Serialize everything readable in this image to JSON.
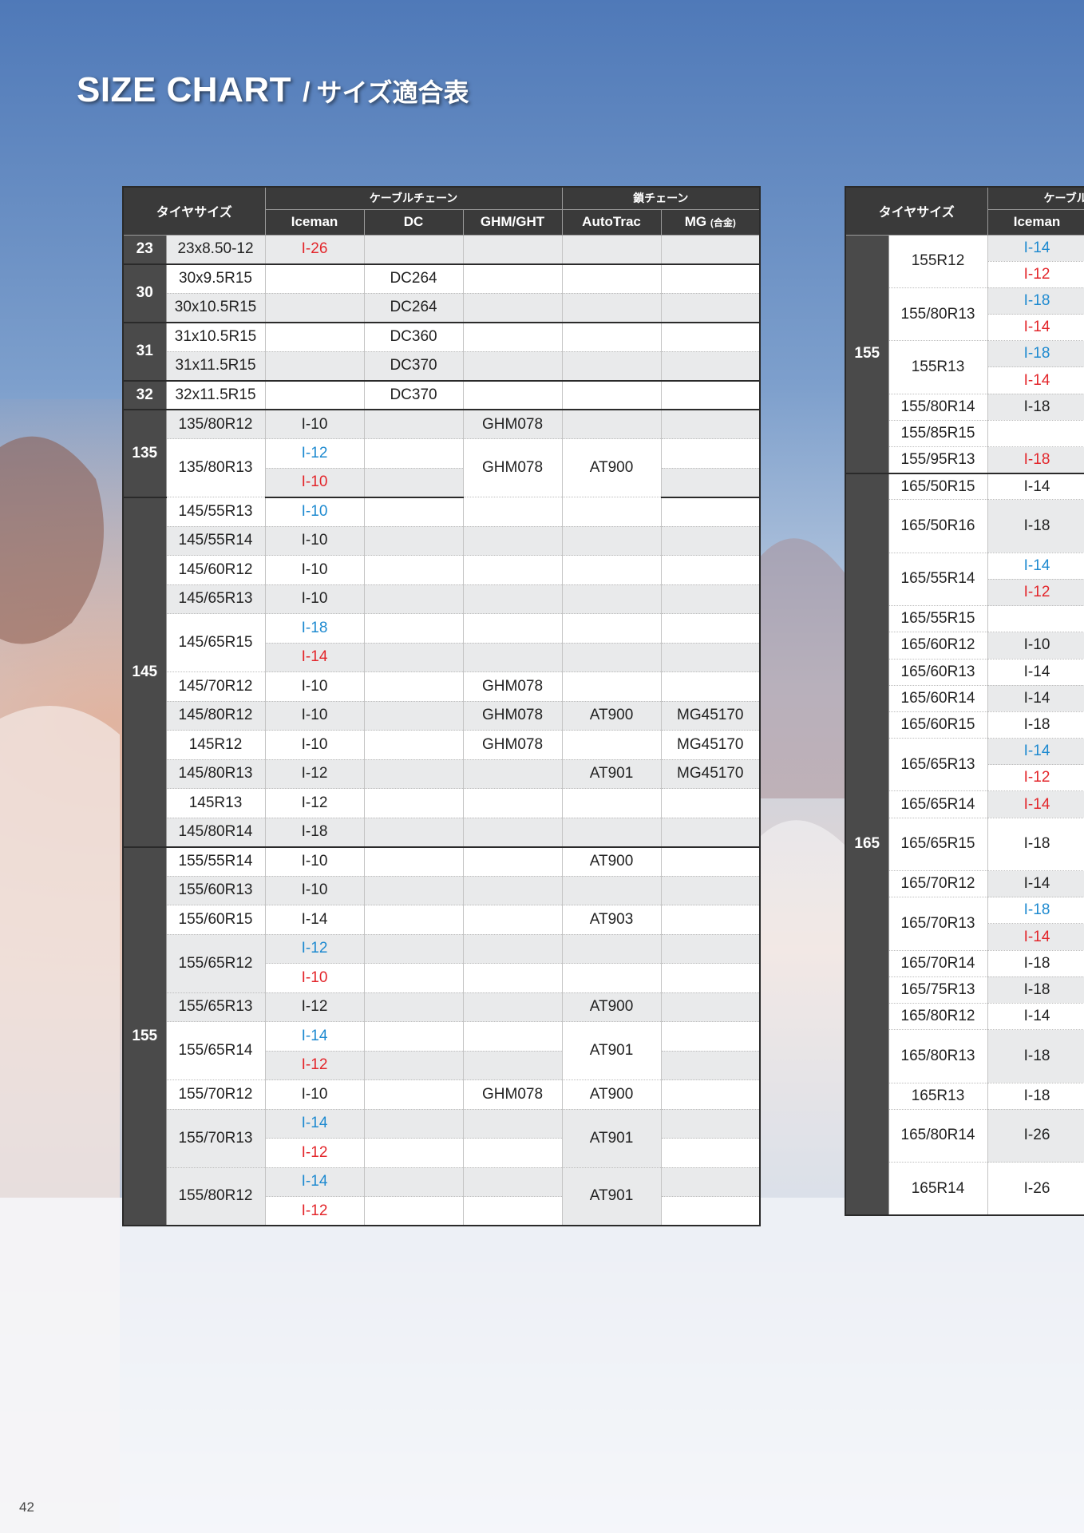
{
  "title": {
    "main": "SIZE CHART",
    "separator": "/",
    "sub": "サイズ適合表"
  },
  "page_number": "42",
  "colors": {
    "blue": "#1e8ad0",
    "red": "#e3262b",
    "header_bg": "#3a3a3a"
  },
  "left_table": {
    "headers": {
      "tire_size": "タイヤサイズ",
      "cable_chain": "ケーブルチェーン",
      "steel_chain": "鎖チェーン",
      "iceman": "Iceman",
      "dc": "DC",
      "ghm": "GHM/GHT",
      "autotrac": "AutoTrac",
      "mg": "MG",
      "mg_note": "(合金)"
    },
    "groups": [
      {
        "label": "23",
        "rows": [
          {
            "size": "23x8.50-12",
            "iceman": [
              {
                "v": "I-26",
                "c": "red"
              }
            ],
            "dc": "",
            "ghm": "",
            "at": "",
            "mg": ""
          }
        ]
      },
      {
        "label": "30",
        "rows": [
          {
            "size": "30x9.5R15",
            "iceman": [],
            "dc": "DC264",
            "ghm": "",
            "at": "",
            "mg": ""
          },
          {
            "size": "30x10.5R15",
            "iceman": [],
            "dc": "DC264",
            "ghm": "",
            "at": "",
            "mg": ""
          }
        ]
      },
      {
        "label": "31",
        "rows": [
          {
            "size": "31x10.5R15",
            "iceman": [],
            "dc": "DC360",
            "ghm": "",
            "at": "",
            "mg": ""
          },
          {
            "size": "31x11.5R15",
            "iceman": [],
            "dc": "DC370",
            "ghm": "",
            "at": "",
            "mg": ""
          }
        ]
      },
      {
        "label": "32",
        "rows": [
          {
            "size": "32x11.5R15",
            "iceman": [],
            "dc": "DC370",
            "ghm": "",
            "at": "",
            "mg": ""
          }
        ]
      },
      {
        "label": "135",
        "rows": [
          {
            "size": "135/80R12",
            "iceman": [
              {
                "v": "I-10",
                "c": ""
              }
            ],
            "dc": "",
            "ghm": "GHM078",
            "at": "",
            "mg": ""
          },
          {
            "size": "135/80R13",
            "iceman": [
              {
                "v": "I-12",
                "c": "blue"
              },
              {
                "v": "I-10",
                "c": "red"
              }
            ],
            "dc": "",
            "ghm": "GHM078",
            "at": "AT900",
            "mg": ""
          }
        ]
      },
      {
        "label": "145",
        "rows": [
          {
            "size": "145/55R13",
            "iceman": [
              {
                "v": "I-10",
                "c": "blue"
              }
            ],
            "dc": "",
            "ghm": "",
            "at": "",
            "mg": ""
          },
          {
            "size": "145/55R14",
            "iceman": [
              {
                "v": "I-10",
                "c": ""
              }
            ],
            "dc": "",
            "ghm": "",
            "at": "",
            "mg": ""
          },
          {
            "size": "145/60R12",
            "iceman": [
              {
                "v": "I-10",
                "c": ""
              }
            ],
            "dc": "",
            "ghm": "",
            "at": "",
            "mg": ""
          },
          {
            "size": "145/65R13",
            "iceman": [
              {
                "v": "I-10",
                "c": ""
              }
            ],
            "dc": "",
            "ghm": "",
            "at": "",
            "mg": ""
          },
          {
            "size": "145/65R15",
            "iceman": [
              {
                "v": "I-18",
                "c": "blue"
              },
              {
                "v": "I-14",
                "c": "red"
              }
            ],
            "dc": "",
            "ghm": "",
            "at": "",
            "mg": ""
          },
          {
            "size": "145/70R12",
            "iceman": [
              {
                "v": "I-10",
                "c": ""
              }
            ],
            "dc": "",
            "ghm": "GHM078",
            "at": "",
            "mg": ""
          },
          {
            "size": "145/80R12",
            "iceman": [
              {
                "v": "I-10",
                "c": ""
              }
            ],
            "dc": "",
            "ghm": "GHM078",
            "at": "AT900",
            "mg": "MG45170"
          },
          {
            "size": "145R12",
            "iceman": [
              {
                "v": "I-10",
                "c": ""
              }
            ],
            "dc": "",
            "ghm": "GHM078",
            "at": "",
            "mg": "MG45170"
          },
          {
            "size": "145/80R13",
            "iceman": [
              {
                "v": "I-12",
                "c": ""
              }
            ],
            "dc": "",
            "ghm": "",
            "at": "AT901",
            "mg": "MG45170"
          },
          {
            "size": "145R13",
            "iceman": [
              {
                "v": "I-12",
                "c": ""
              }
            ],
            "dc": "",
            "ghm": "",
            "at": "",
            "mg": ""
          },
          {
            "size": "145/80R14",
            "iceman": [
              {
                "v": "I-18",
                "c": ""
              }
            ],
            "dc": "",
            "ghm": "",
            "at": "",
            "mg": ""
          }
        ]
      },
      {
        "label": "155",
        "rows": [
          {
            "size": "155/55R14",
            "iceman": [
              {
                "v": "I-10",
                "c": ""
              }
            ],
            "dc": "",
            "ghm": "",
            "at": "AT900",
            "mg": ""
          },
          {
            "size": "155/60R13",
            "iceman": [
              {
                "v": "I-10",
                "c": ""
              }
            ],
            "dc": "",
            "ghm": "",
            "at": "",
            "mg": ""
          },
          {
            "size": "155/60R15",
            "iceman": [
              {
                "v": "I-14",
                "c": ""
              }
            ],
            "dc": "",
            "ghm": "",
            "at": "AT903",
            "mg": ""
          },
          {
            "size": "155/65R12",
            "iceman": [
              {
                "v": "I-12",
                "c": "blue"
              },
              {
                "v": "I-10",
                "c": "red"
              }
            ],
            "dc": "",
            "ghm": "",
            "at": "",
            "mg": ""
          },
          {
            "size": "155/65R13",
            "iceman": [
              {
                "v": "I-12",
                "c": ""
              }
            ],
            "dc": "",
            "ghm": "",
            "at": "AT900",
            "mg": ""
          },
          {
            "size": "155/65R14",
            "iceman": [
              {
                "v": "I-14",
                "c": "blue"
              },
              {
                "v": "I-12",
                "c": "red"
              }
            ],
            "dc": "",
            "ghm": "",
            "at": "AT901",
            "mg": ""
          },
          {
            "size": "155/70R12",
            "iceman": [
              {
                "v": "I-10",
                "c": ""
              }
            ],
            "dc": "",
            "ghm": "GHM078",
            "at": "AT900",
            "mg": ""
          },
          {
            "size": "155/70R13",
            "iceman": [
              {
                "v": "I-14",
                "c": "blue"
              },
              {
                "v": "I-12",
                "c": "red"
              }
            ],
            "dc": "",
            "ghm": "",
            "at": "AT901",
            "mg": ""
          },
          {
            "size": "155/80R12",
            "iceman": [
              {
                "v": "I-14",
                "c": "blue"
              },
              {
                "v": "I-12",
                "c": "red"
              }
            ],
            "dc": "",
            "ghm": "",
            "at": "AT901",
            "mg": ""
          }
        ]
      }
    ]
  },
  "right_table": {
    "headers": {
      "tire_size": "タイヤサイズ",
      "cable_chain": "ケーブル",
      "iceman": "Iceman"
    },
    "groups": [
      {
        "label": "155",
        "rows": [
          {
            "size": "155R12",
            "iceman": [
              {
                "v": "I-14",
                "c": "blue"
              },
              {
                "v": "I-12",
                "c": "red"
              }
            ]
          },
          {
            "size": "155/80R13",
            "iceman": [
              {
                "v": "I-18",
                "c": "blue"
              },
              {
                "v": "I-14",
                "c": "red"
              }
            ]
          },
          {
            "size": "155R13",
            "iceman": [
              {
                "v": "I-18",
                "c": "blue"
              },
              {
                "v": "I-14",
                "c": "red"
              }
            ]
          },
          {
            "size": "155/80R14",
            "iceman": [
              {
                "v": "I-18",
                "c": ""
              }
            ]
          },
          {
            "size": "155/85R15",
            "iceman": []
          },
          {
            "size": "155/95R13",
            "iceman": [
              {
                "v": "I-18",
                "c": "red"
              }
            ]
          }
        ]
      },
      {
        "label": "165",
        "rows": [
          {
            "size": "165/50R15",
            "iceman": [
              {
                "v": "I-14",
                "c": ""
              }
            ]
          },
          {
            "size": "165/50R16",
            "iceman": [
              {
                "v": "I-18",
                "c": ""
              }
            ],
            "tall": true
          },
          {
            "size": "165/55R14",
            "iceman": [
              {
                "v": "I-14",
                "c": "blue"
              },
              {
                "v": "I-12",
                "c": "red"
              }
            ]
          },
          {
            "size": "165/55R15",
            "iceman": []
          },
          {
            "size": "165/60R12",
            "iceman": [
              {
                "v": "I-10",
                "c": ""
              }
            ]
          },
          {
            "size": "165/60R13",
            "iceman": [
              {
                "v": "I-14",
                "c": ""
              }
            ]
          },
          {
            "size": "165/60R14",
            "iceman": [
              {
                "v": "I-14",
                "c": ""
              }
            ]
          },
          {
            "size": "165/60R15",
            "iceman": [
              {
                "v": "I-18",
                "c": ""
              }
            ]
          },
          {
            "size": "165/65R13",
            "iceman": [
              {
                "v": "I-14",
                "c": "blue"
              },
              {
                "v": "I-12",
                "c": "red"
              }
            ]
          },
          {
            "size": "165/65R14",
            "iceman": [
              {
                "v": "I-14",
                "c": "red"
              }
            ]
          },
          {
            "size": "165/65R15",
            "iceman": [
              {
                "v": "I-18",
                "c": ""
              }
            ],
            "tall": true
          },
          {
            "size": "165/70R12",
            "iceman": [
              {
                "v": "I-14",
                "c": ""
              }
            ]
          },
          {
            "size": "165/70R13",
            "iceman": [
              {
                "v": "I-18",
                "c": "blue"
              },
              {
                "v": "I-14",
                "c": "red"
              }
            ]
          },
          {
            "size": "165/70R14",
            "iceman": [
              {
                "v": "I-18",
                "c": ""
              }
            ]
          },
          {
            "size": "165/75R13",
            "iceman": [
              {
                "v": "I-18",
                "c": ""
              }
            ]
          },
          {
            "size": "165/80R12",
            "iceman": [
              {
                "v": "I-14",
                "c": ""
              }
            ]
          },
          {
            "size": "165/80R13",
            "iceman": [
              {
                "v": "I-18",
                "c": ""
              }
            ],
            "tall": true
          },
          {
            "size": "165R13",
            "iceman": [
              {
                "v": "I-18",
                "c": ""
              }
            ]
          },
          {
            "size": "165/80R14",
            "iceman": [
              {
                "v": "I-26",
                "c": ""
              }
            ],
            "tall": true
          },
          {
            "size": "165R14",
            "iceman": [
              {
                "v": "I-26",
                "c": ""
              }
            ],
            "tall": true
          }
        ]
      }
    ]
  }
}
